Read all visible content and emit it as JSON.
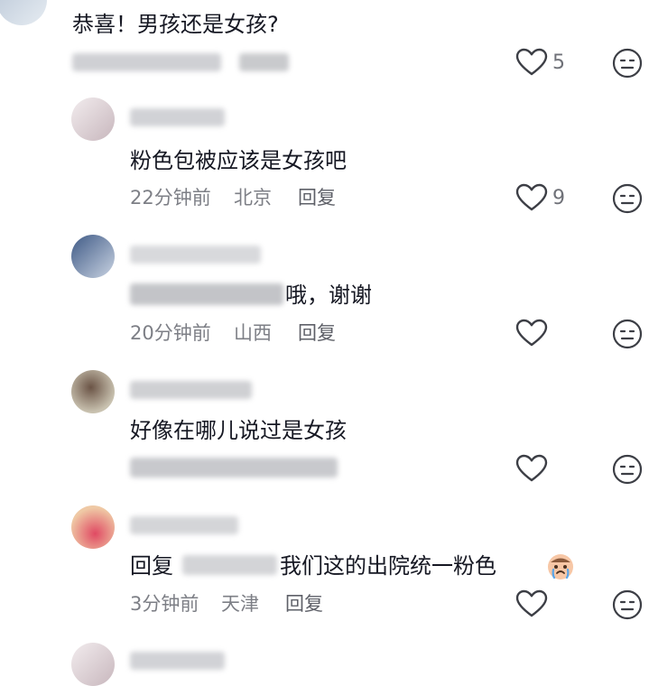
{
  "top": {
    "text": "恭喜！男孩还是女孩?",
    "likes": "5"
  },
  "replies": [
    {
      "text": "粉色包被应该是女孩吧",
      "time": "22分钟前",
      "location": "北京",
      "reply": "回复",
      "likes": "9"
    },
    {
      "text": "哦，谢谢",
      "time": "20分钟前",
      "location": "山西",
      "reply": "回复",
      "likes": ""
    },
    {
      "text": "好像在哪儿说过是女孩",
      "likes": ""
    },
    {
      "prefix": "回复",
      "text": "我们这的出院统一粉色",
      "emoji_icon": "crying-emoji-icon",
      "time": "3分钟前",
      "location": "天津",
      "reply": "回复",
      "likes": ""
    }
  ],
  "colors": {
    "text": "#161823",
    "meta": "#7d7f86",
    "icon": "#3c3e45"
  }
}
